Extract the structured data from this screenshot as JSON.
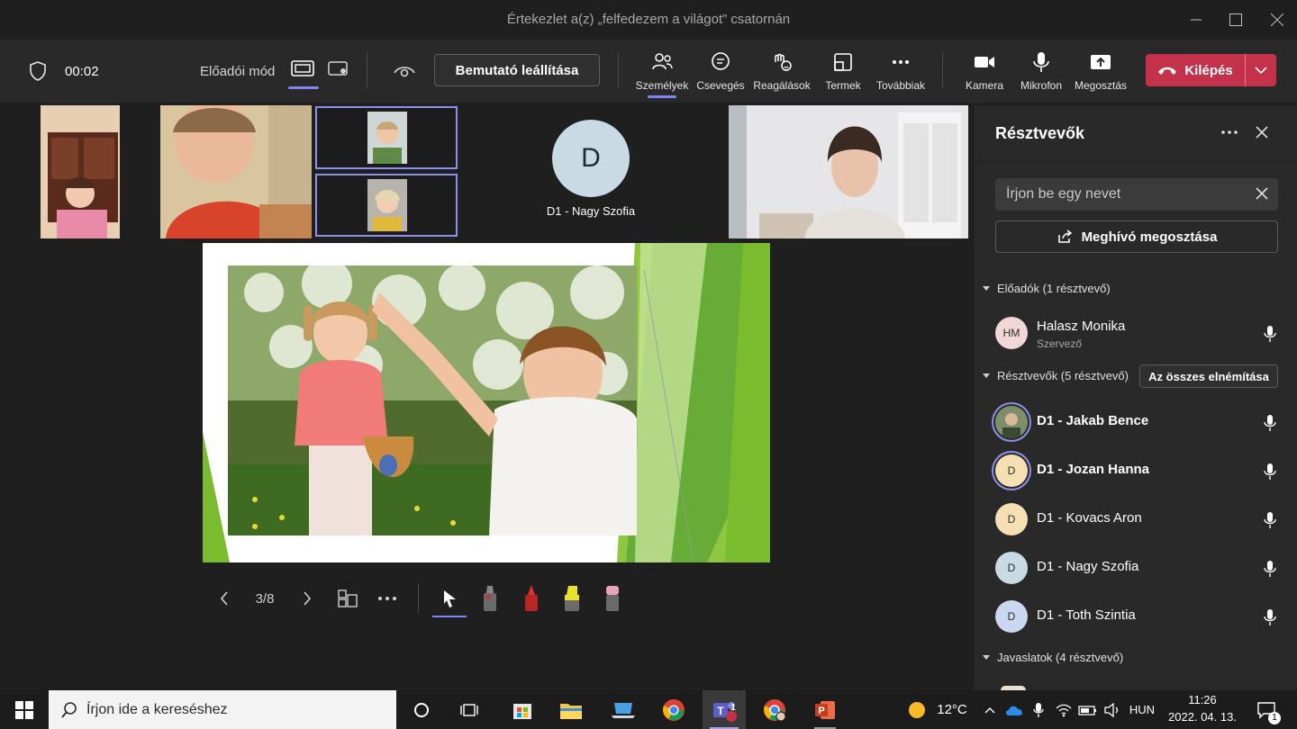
{
  "window": {
    "title": "Értekezlet a(z) „felfedezem a világot” csatornán"
  },
  "toolbar": {
    "timer": "00:02",
    "presenter_mode_label": "Előadói mód",
    "stop_presenting": "Bemutató leállítása",
    "items": [
      {
        "label": "Személyek",
        "icon": "people-icon"
      },
      {
        "label": "Csevegés",
        "icon": "chat-icon"
      },
      {
        "label": "Reagálások",
        "icon": "reactions-icon"
      },
      {
        "label": "Termek",
        "icon": "rooms-icon"
      },
      {
        "label": "Továbbiak",
        "icon": "more-icon"
      },
      {
        "label": "Kamera",
        "icon": "camera-icon"
      },
      {
        "label": "Mikrofon",
        "icon": "microphone-icon"
      },
      {
        "label": "Megosztás",
        "icon": "share-icon"
      }
    ],
    "leave": "Kilépés"
  },
  "strip": {
    "avatar_initial": "D",
    "avatar_name": "D1 - Nagy Szofia"
  },
  "presenter_controls": {
    "page": "3/8"
  },
  "panel": {
    "title": "Résztvevők",
    "search_placeholder": "Írjon be egy nevet",
    "invite": "Meghívó megosztása",
    "presenters_section": "Előadók (1 résztvevő)",
    "presenters": [
      {
        "initials": "HM",
        "name": "Halasz Monika",
        "role": "Szervező"
      }
    ],
    "attendees_section": "Résztvevők (5 résztvevő)",
    "mute_all": "Az összes elnémítása",
    "attendees": [
      {
        "initials": "",
        "name": "D1 - Jakab Bence"
      },
      {
        "initials": "D",
        "name": "D1 - Jozan Hanna"
      },
      {
        "initials": "D",
        "name": "D1 - Kovacs Aron"
      },
      {
        "initials": "D",
        "name": "D1 - Nagy Szofia"
      },
      {
        "initials": "D",
        "name": "D1 - Toth Szintia"
      }
    ],
    "suggestions_section": "Javaslatok (4 résztvevő)"
  },
  "taskbar": {
    "search_placeholder": "Írjon ide a kereséshez",
    "weather": "12°C",
    "language": "HUN",
    "time": "11:26",
    "date": "2022. 04. 13.",
    "teams_badge": "1",
    "notification_badge": "1"
  },
  "colors": {
    "accent": "#7f85f5",
    "leave": "#c4314b",
    "panel": "#292929"
  }
}
